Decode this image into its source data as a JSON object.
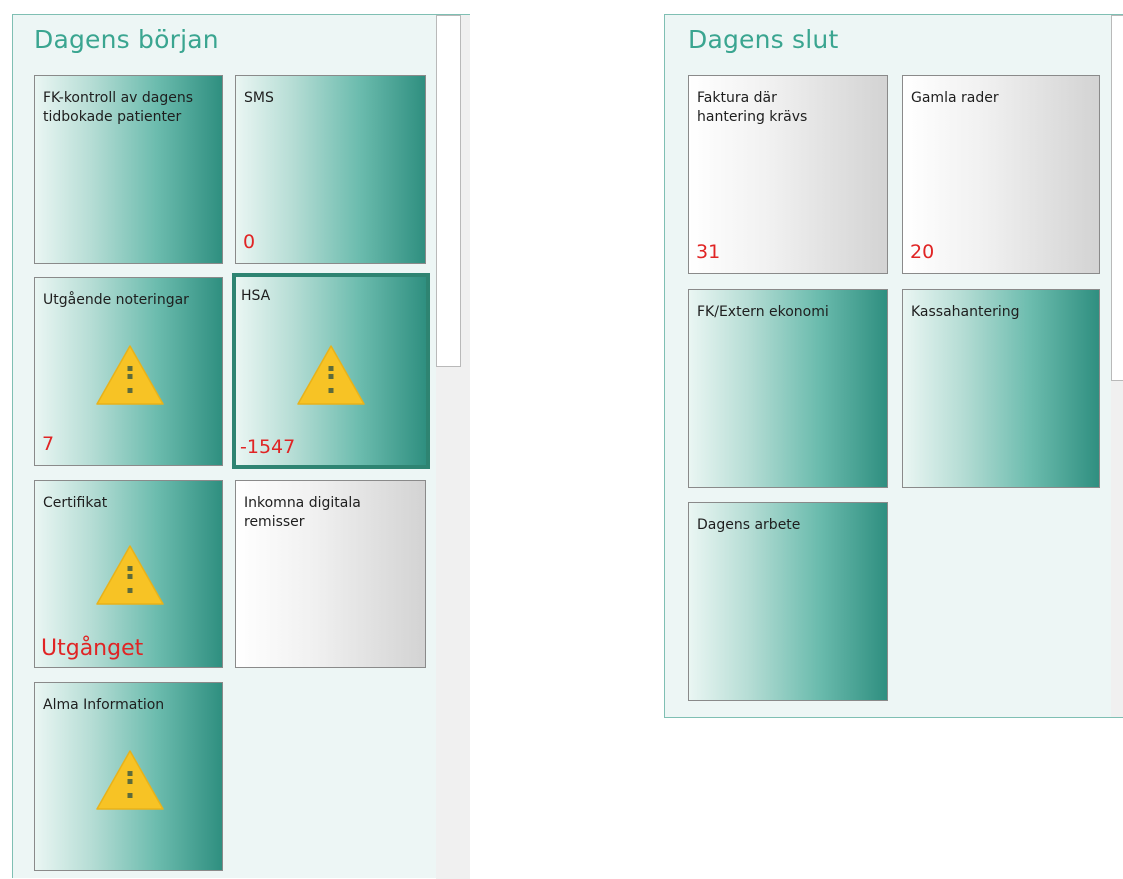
{
  "colors": {
    "accent": "#3aa590",
    "tile_teal_dark": "#2f8f80",
    "count_red": "#e02424",
    "panel_bg": "#edf6f5"
  },
  "left_panel": {
    "title": "Dagens början",
    "tiles": [
      {
        "label": "FK-kontroll av dagens tidbokade patienter",
        "style": "teal"
      },
      {
        "label": "SMS",
        "count": "0",
        "style": "teal"
      },
      {
        "label": "Utgående noteringar",
        "count": "7",
        "icon": "warning-icon",
        "style": "teal"
      },
      {
        "label": "HSA",
        "count": "-1547",
        "icon": "warning-icon",
        "style": "teal",
        "selected": true
      },
      {
        "label": "Certifikat",
        "status": "Utgånget",
        "icon": "warning-icon",
        "style": "teal"
      },
      {
        "label": "Inkomna digitala remisser",
        "style": "gray"
      },
      {
        "label": "Alma Information",
        "icon": "warning-icon",
        "style": "teal"
      }
    ]
  },
  "right_panel": {
    "title": "Dagens slut",
    "tiles": [
      {
        "label": "Faktura där hantering krävs",
        "count": "31",
        "style": "gray"
      },
      {
        "label": "Gamla rader",
        "count": "20",
        "style": "gray"
      },
      {
        "label": "FK/Extern ekonomi",
        "style": "teal"
      },
      {
        "label": "Kassahantering",
        "style": "teal"
      },
      {
        "label": "Dagens arbete",
        "style": "teal"
      }
    ]
  }
}
